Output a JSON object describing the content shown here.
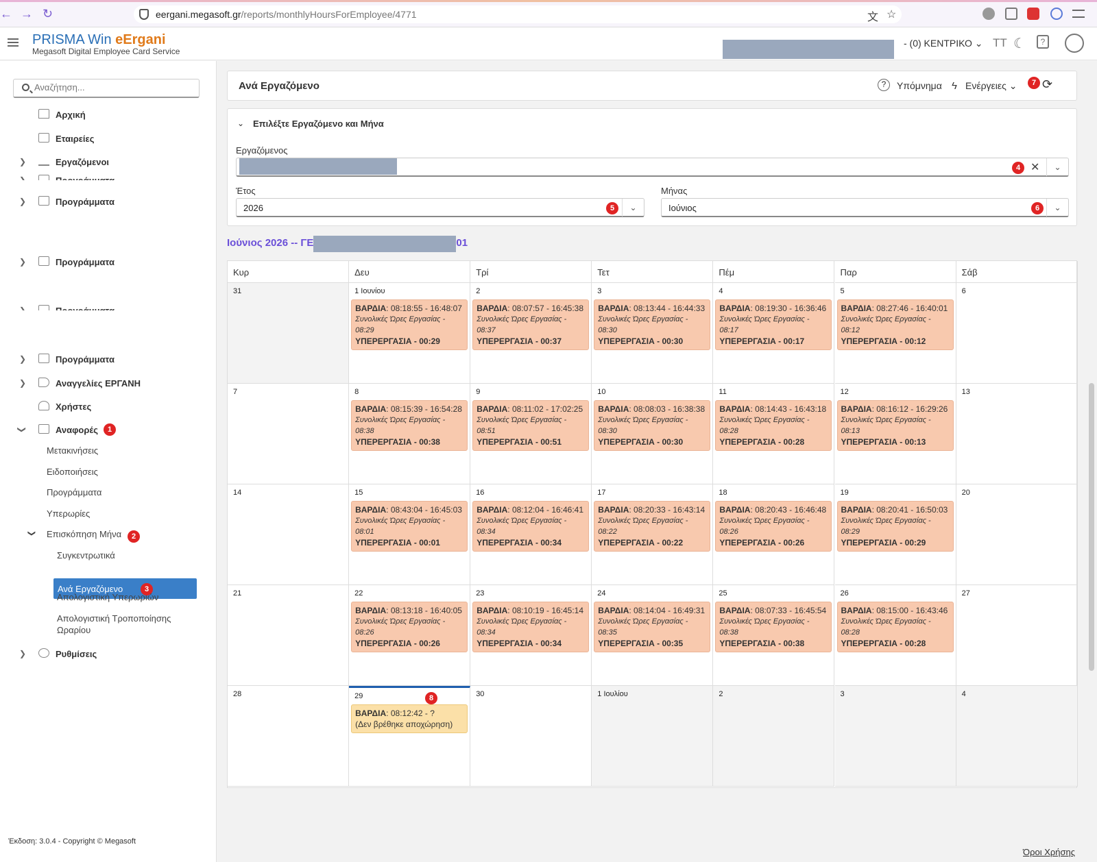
{
  "browser": {
    "url_host": "eergani.megasoft.gr",
    "url_path": "/reports/monthlyHoursForEmployee/4771"
  },
  "brand": {
    "title_a": "PRISMA Win ",
    "title_b": "eErgani",
    "subtitle": "Megasoft Digital Employee Card Service"
  },
  "header": {
    "company": "- (0) ΚΕΝΤΡΙΚΟ",
    "font_icon": "TT"
  },
  "sidebar": {
    "search_placeholder": "Αναζήτηση...",
    "home": "Αρχική",
    "companies": "Εταιρείες",
    "employees": "Εργαζόμενοι",
    "programs": "Προγράμματα",
    "announcements": "Αναγγελίες ΕΡΓΑΝΗ",
    "users": "Χρήστες",
    "reports": "Αναφορές",
    "sub": {
      "moves": "Μετακινήσεις",
      "notifications": "Ειδοποιήσεις",
      "programs": "Προγράμματα",
      "overtime": "Υπερωρίες",
      "month_overview": "Επισκόπηση Μήνα",
      "summary": "Συγκεντρωτικά",
      "per_employee": "Ανά Εργαζόμενο",
      "overtime_report": "Απολογιστική Υπερωριών",
      "schedule_report": "Απολογιστική Τροποποίησης Ωραρίου"
    },
    "settings": "Ρυθμίσεις",
    "footer": "Έκδοση: 3.0.4 - Copyright © Megasoft"
  },
  "badges": [
    "1",
    "2",
    "3",
    "4",
    "5",
    "6",
    "7",
    "8"
  ],
  "page": {
    "title": "Ανά Εργαζόμενο",
    "legend": "Υπόμνημα",
    "actions": "Ενέργειες",
    "filter_title": "Επιλέξτε Εργαζόμενο και Μήνα",
    "employee_label": "Εργαζόμενος",
    "year_label": "Έτος",
    "year_value": "2026",
    "month_label": "Μήνας",
    "month_value": "Ιούνιος",
    "cal_title_prefix": "Ιούνιος 2026 -- ΓΕ",
    "cal_title_suffix": "01",
    "terms": "Όροι Χρήσης"
  },
  "calendar": {
    "days": [
      "Κυρ",
      "Δευ",
      "Τρί",
      "Τετ",
      "Πέμ",
      "Παρ",
      "Σάβ"
    ],
    "shift_label": "ΒΑΡΔΙΑ",
    "total_label": "Συνολικές Ώρες Εργασίας -",
    "overtime_label": "ΥΠΕΡΕΡΓΑΣΙΑ -",
    "weeks": [
      [
        {
          "d": "31",
          "gray": true
        },
        {
          "d": "1 Ιουνίου",
          "ev": {
            "t": "08:18:55 - 16:48:07",
            "h": "08:29",
            "o": "00:29"
          }
        },
        {
          "d": "2",
          "ev": {
            "t": "08:07:57 - 16:45:38",
            "h": "08:37",
            "o": "00:37"
          }
        },
        {
          "d": "3",
          "ev": {
            "t": "08:13:44 - 16:44:33",
            "h": "08:30",
            "o": "00:30"
          }
        },
        {
          "d": "4",
          "ev": {
            "t": "08:19:30 - 16:36:46",
            "h": "08:17",
            "o": "00:17"
          }
        },
        {
          "d": "5",
          "ev": {
            "t": "08:27:46 - 16:40:01",
            "h": "08:12",
            "o": "00:12"
          }
        },
        {
          "d": "6"
        }
      ],
      [
        {
          "d": "7"
        },
        {
          "d": "8",
          "ev": {
            "t": "08:15:39 - 16:54:28",
            "h": "08:38",
            "o": "00:38"
          }
        },
        {
          "d": "9",
          "ev": {
            "t": "08:11:02 - 17:02:25",
            "h": "08:51",
            "o": "00:51"
          }
        },
        {
          "d": "10",
          "ev": {
            "t": "08:08:03 - 16:38:38",
            "h": "08:30",
            "o": "00:30"
          }
        },
        {
          "d": "11",
          "ev": {
            "t": "08:14:43 - 16:43:18",
            "h": "08:28",
            "o": "00:28"
          }
        },
        {
          "d": "12",
          "ev": {
            "t": "08:16:12 - 16:29:26",
            "h": "08:13",
            "o": "00:13"
          }
        },
        {
          "d": "13"
        }
      ],
      [
        {
          "d": "14"
        },
        {
          "d": "15",
          "ev": {
            "t": "08:43:04 - 16:45:03",
            "h": "08:01",
            "o": "00:01"
          }
        },
        {
          "d": "16",
          "ev": {
            "t": "08:12:04 - 16:46:41",
            "h": "08:34",
            "o": "00:34"
          }
        },
        {
          "d": "17",
          "ev": {
            "t": "08:20:33 - 16:43:14",
            "h": "08:22",
            "o": "00:22"
          }
        },
        {
          "d": "18",
          "ev": {
            "t": "08:20:43 - 16:46:48",
            "h": "08:26",
            "o": "00:26"
          }
        },
        {
          "d": "19",
          "ev": {
            "t": "08:20:41 - 16:50:03",
            "h": "08:29",
            "o": "00:29"
          }
        },
        {
          "d": "20"
        }
      ],
      [
        {
          "d": "21"
        },
        {
          "d": "22",
          "ev": {
            "t": "08:13:18 - 16:40:05",
            "h": "08:26",
            "o": "00:26"
          }
        },
        {
          "d": "23",
          "ev": {
            "t": "08:10:19 - 16:45:14",
            "h": "08:34",
            "o": "00:34"
          }
        },
        {
          "d": "24",
          "ev": {
            "t": "08:14:04 - 16:49:31",
            "h": "08:35",
            "o": "00:35"
          }
        },
        {
          "d": "25",
          "ev": {
            "t": "08:07:33 - 16:45:54",
            "h": "08:38",
            "o": "00:38"
          }
        },
        {
          "d": "26",
          "ev": {
            "t": "08:15:00 - 16:43:46",
            "h": "08:28",
            "o": "00:28"
          }
        },
        {
          "d": "27"
        }
      ],
      [
        {
          "d": "28"
        },
        {
          "d": "29",
          "today": true,
          "pending": {
            "t": "08:12:42 - ?",
            "note": "(Δεν βρέθηκε αποχώρηση)"
          }
        },
        {
          "d": "30"
        },
        {
          "d": "1 Ιουλίου",
          "gray": true
        },
        {
          "d": "2",
          "gray": true
        },
        {
          "d": "3",
          "gray": true
        },
        {
          "d": "4",
          "gray": true
        }
      ]
    ]
  }
}
